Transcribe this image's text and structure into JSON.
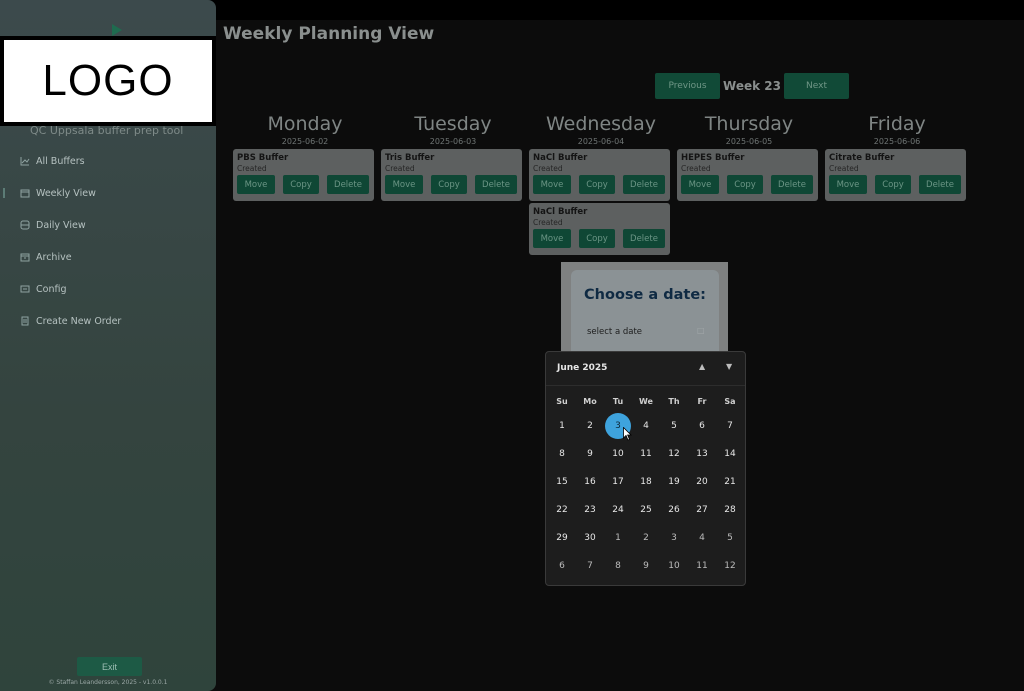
{
  "sidebar": {
    "logo_text": "LOGO",
    "subtitle": "QC Uppsala buffer prep tool",
    "items": [
      {
        "label": "All Buffers",
        "icon": "chart-icon"
      },
      {
        "label": "Weekly View",
        "icon": "calendar-icon"
      },
      {
        "label": "Daily View",
        "icon": "database-icon"
      },
      {
        "label": "Archive",
        "icon": "archive-icon"
      },
      {
        "label": "Config",
        "icon": "config-icon"
      },
      {
        "label": "Create New Order",
        "icon": "order-icon"
      }
    ],
    "exit_label": "Exit",
    "footer": "© Staffan Leandersson, 2025 - v1.0.0.1"
  },
  "main": {
    "title": "Weekly Planning View",
    "week": {
      "prev_label": "Previous",
      "label": "Week 23",
      "next_label": "Next"
    },
    "days": [
      {
        "name": "Monday",
        "date": "2025-06-02",
        "cards": [
          {
            "title": "PBS Buffer",
            "status": "Created"
          }
        ]
      },
      {
        "name": "Tuesday",
        "date": "2025-06-03",
        "cards": [
          {
            "title": "Tris Buffer",
            "status": "Created"
          }
        ]
      },
      {
        "name": "Wednesday",
        "date": "2025-06-04",
        "cards": [
          {
            "title": "NaCl Buffer",
            "status": "Created"
          },
          {
            "title": "NaCl Buffer",
            "status": "Created"
          }
        ]
      },
      {
        "name": "Thursday",
        "date": "2025-06-05",
        "cards": [
          {
            "title": "HEPES Buffer",
            "status": "Created"
          }
        ]
      },
      {
        "name": "Friday",
        "date": "2025-06-06",
        "cards": [
          {
            "title": "Citrate Buffer",
            "status": "Created"
          }
        ]
      }
    ],
    "card_actions": {
      "move": "Move",
      "copy": "Copy",
      "delete": "Delete"
    }
  },
  "dialog": {
    "title": "Choose a date:",
    "input_placeholder": "select a date"
  },
  "calendar": {
    "month": "June 2025",
    "weekdays": [
      "Su",
      "Mo",
      "Tu",
      "We",
      "Th",
      "Fr",
      "Sa"
    ],
    "days": [
      "1",
      "2",
      "3",
      "4",
      "5",
      "6",
      "7",
      "8",
      "9",
      "10",
      "11",
      "12",
      "13",
      "14",
      "15",
      "16",
      "17",
      "18",
      "19",
      "20",
      "21",
      "22",
      "23",
      "24",
      "25",
      "26",
      "27",
      "28",
      "29",
      "30",
      "1",
      "2",
      "3",
      "4",
      "5",
      "6",
      "7",
      "8",
      "9",
      "10",
      "11",
      "12"
    ],
    "selected_index": 2,
    "current_month_count": 30,
    "accent": "#3ea3dd"
  }
}
